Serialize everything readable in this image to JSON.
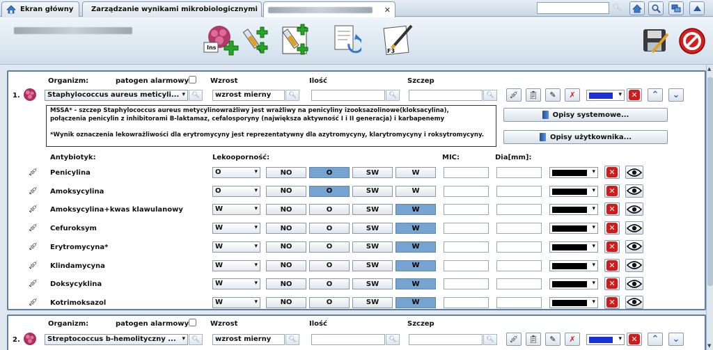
{
  "tabs": [
    {
      "label": "Ekran główny",
      "icon": "home-icon"
    },
    {
      "label": "Zarządzanie wynikami mikrobiologicznymi",
      "icon": "bacteria-icon",
      "closable": true
    }
  ],
  "toolbar": {
    "search_value": "",
    "insert_label": "Ins",
    "f3_label": "F3"
  },
  "panel1": {
    "index": "1.",
    "organism_label": "Organizm:",
    "alarm_label": "patogen alarmowy:",
    "growth_label": "Wzrost",
    "quantity_label": "Ilość",
    "strain_label": "Szczep",
    "organism_value": "Staphylococcus aureus meticyli...",
    "growth_value": "wzrost mierny",
    "quantity_value": "",
    "strain_value": "",
    "note_lines": [
      "MSSA* - szczep Staphylococcus aureus  metycylinowrażliwy  jest wrażliwy na penicyliny izooksazolinowe(kloksacylina),",
      "połączenia penicylin z  inhibitorami B-laktamaz, cefalosporyny  (największa aktywność I i II generacja) i karbapenemy",
      "",
      "*Wynik oznaczenia lekowrażliwości dla erytromycyny jest reprezentatywny dla azytromycyny, klarytromycyny i roksytromycyny."
    ],
    "btn_system": "Opisy systemowe...",
    "btn_user": "Opisy użytkownika...",
    "color": "#1a2fd6"
  },
  "antibiotics": {
    "col_name": "Antybiotyk:",
    "col_resistance": "Lekooporność:",
    "col_mic": "MIC:",
    "col_dia": "Dia[mm]:",
    "res_buttons": [
      "NO",
      "O",
      "SW",
      "W"
    ],
    "rows": [
      {
        "name": "Penicylina",
        "resistance": "O",
        "mic": "",
        "dia": ""
      },
      {
        "name": "Amoksycylina",
        "resistance": "O",
        "mic": "",
        "dia": ""
      },
      {
        "name": "Amoksycylina+kwas klawulanowy",
        "resistance": "W",
        "mic": "",
        "dia": ""
      },
      {
        "name": "Cefuroksym",
        "resistance": "W",
        "mic": "",
        "dia": ""
      },
      {
        "name": "Erytromycyna*",
        "resistance": "W",
        "mic": "",
        "dia": ""
      },
      {
        "name": "Klindamycyna",
        "resistance": "W",
        "mic": "",
        "dia": ""
      },
      {
        "name": "Doksycyklina",
        "resistance": "W",
        "mic": "",
        "dia": ""
      },
      {
        "name": "Kotrimoksazol",
        "resistance": "W",
        "mic": "",
        "dia": ""
      }
    ],
    "row_color": "#000000"
  },
  "panel2": {
    "index": "2.",
    "organism_label": "Organizm:",
    "alarm_label": "patogen alarmowy:",
    "growth_label": "Wzrost",
    "quantity_label": "Ilość",
    "strain_label": "Szczep",
    "organism_value": "Streptococcus b-hemolityczny ...",
    "growth_value": "wzrost mierny",
    "quantity_value": "",
    "strain_value": "",
    "color": "#1a2fd6"
  }
}
